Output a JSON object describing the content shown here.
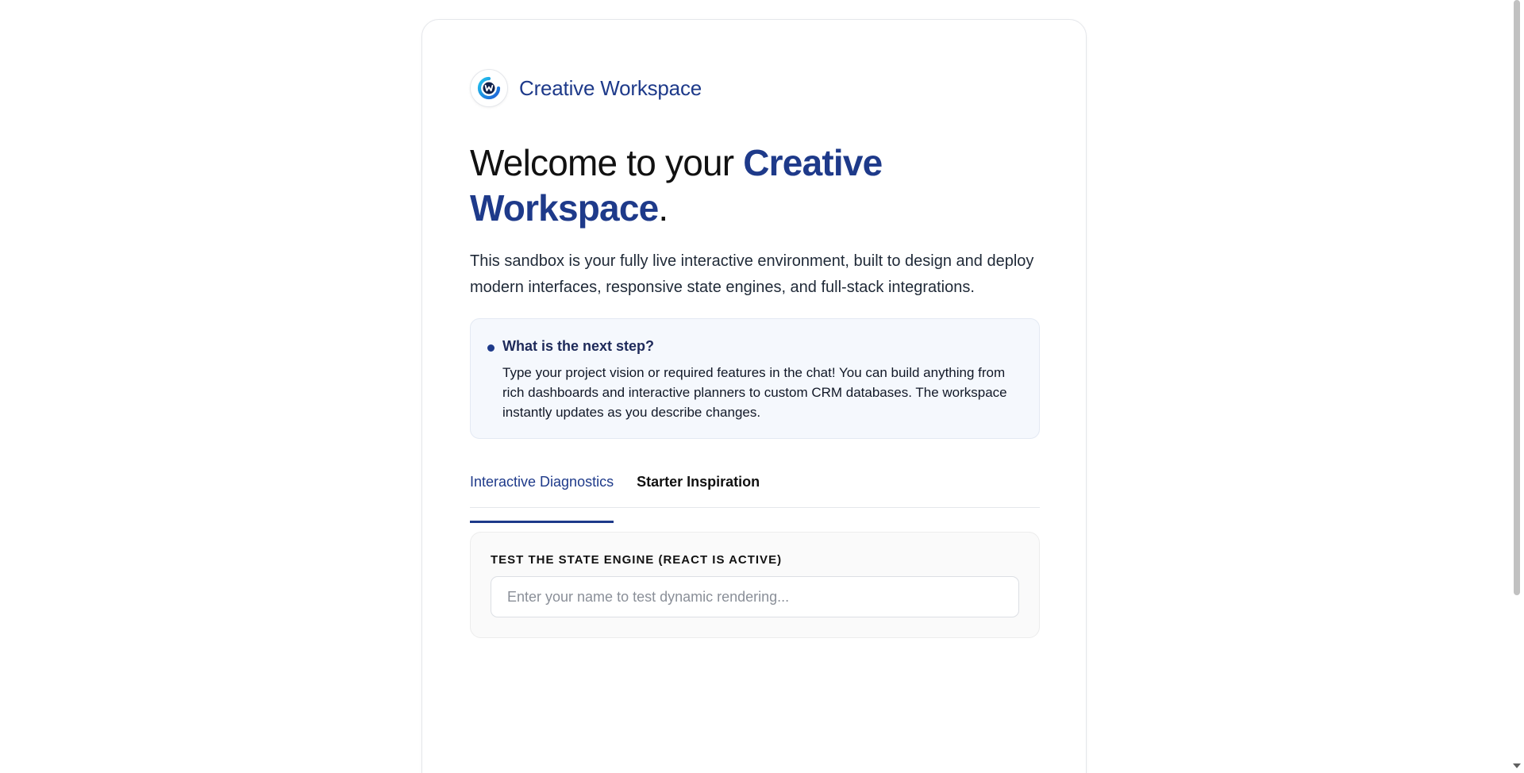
{
  "brand": {
    "name": "Creative Workspace",
    "logo_icon": "workspace-logo-icon",
    "logo_letter": "W"
  },
  "headline": {
    "prefix": "Welcome to your ",
    "accent": "Creative Workspace",
    "suffix": "."
  },
  "intro": "This sandbox is your fully live interactive environment, built to design and deploy modern interfaces, responsive state engines, and full-stack integrations.",
  "callout": {
    "title": "What is the next step?",
    "body": "Type your project vision or required features in the chat! You can build anything from rich dashboards and interactive planners to custom CRM databases. The workspace instantly updates as you describe changes."
  },
  "tabs": [
    {
      "label": "Interactive Diagnostics",
      "active": true
    },
    {
      "label": "Starter Inspiration",
      "active": false
    }
  ],
  "diagnostics": {
    "label": "TEST THE STATE ENGINE (REACT IS ACTIVE)",
    "input_value": "",
    "input_placeholder": "Enter your name to test dynamic rendering..."
  },
  "colors": {
    "accent": "#1e3a8a",
    "callout_bg": "#f5f8fd",
    "panel_bg": "#fafafa"
  }
}
